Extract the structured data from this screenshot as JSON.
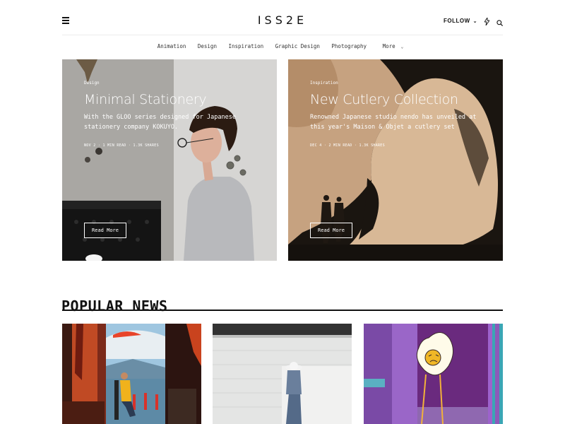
{
  "header": {
    "logo": "ISS2E",
    "follow_label": "FOLLOW"
  },
  "nav": {
    "items": [
      "Animation",
      "Design",
      "Inspiration",
      "Graphic Design",
      "Photography"
    ],
    "more_label": "More"
  },
  "hero": [
    {
      "category": "Design",
      "title": "Minimal Stationery",
      "excerpt": "With the GLOO series designed for Japanese stationery company KOKUYO.",
      "meta": "NOV 2 · 1 MIN READ · 1.3K SHARES",
      "read_more": "Read More"
    },
    {
      "category": "Inspiration",
      "title": "New Cutlery Collection",
      "excerpt": "Renowned Japanese studio nendo has unveiled at this year's Maison & Objet a cutlery set",
      "meta": "DEC 4 · 2 MIN READ · 1.3K SHARES",
      "read_more": "Read More"
    }
  ],
  "popular": {
    "title": "POPULAR NEWS"
  },
  "icons": {
    "menu": "hamburger-menu-icon",
    "follow_chevron": "chevron-down-icon",
    "bolt": "lightning-bolt-icon",
    "search": "search-icon"
  },
  "colors": {
    "text": "#111111",
    "nav_text": "#333333",
    "divider": "#ececec"
  }
}
